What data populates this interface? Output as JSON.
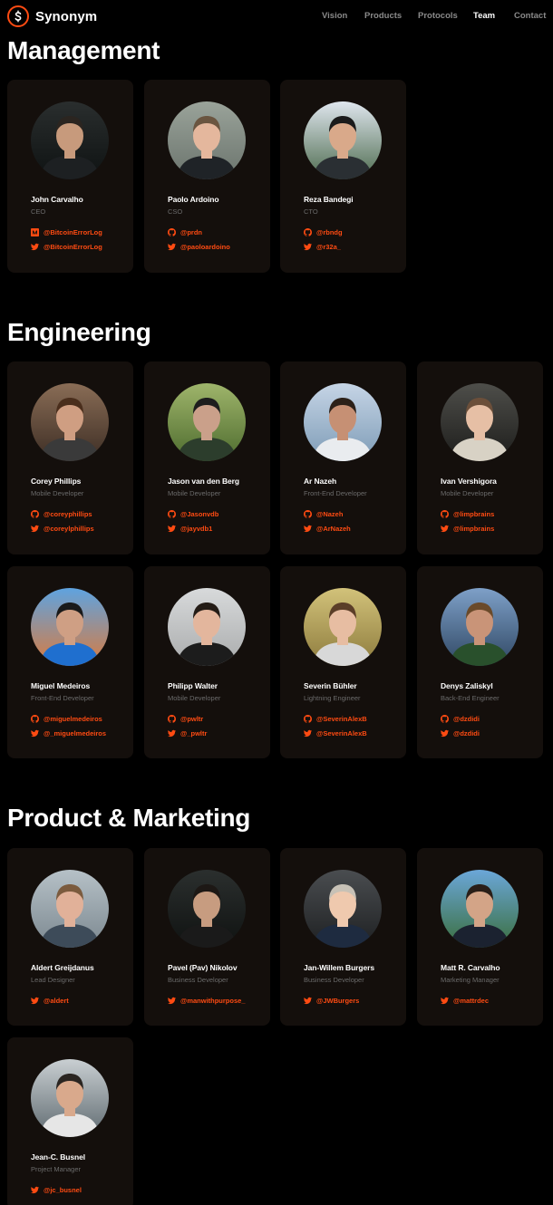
{
  "brand": {
    "name": "Synonym",
    "accent": "#ff4b12"
  },
  "nav": [
    {
      "label": "Vision"
    },
    {
      "label": "Products"
    },
    {
      "label": "Protocols"
    },
    {
      "label": "Team",
      "active": true
    },
    {
      "label": "Contact"
    }
  ],
  "sections": [
    {
      "title": "Management",
      "members": [
        {
          "name": "John Carvalho",
          "role": "CEO",
          "links": [
            {
              "icon": "medium-icon",
              "text": "@BitcoinErrorLog"
            },
            {
              "icon": "twitter-icon",
              "text": "@BitcoinErrorLog"
            }
          ]
        },
        {
          "name": "Paolo Ardoino",
          "role": "CSO",
          "links": [
            {
              "icon": "github-icon",
              "text": "@prdn"
            },
            {
              "icon": "twitter-icon",
              "text": "@paoloardoino"
            }
          ]
        },
        {
          "name": "Reza Bandegi",
          "role": "CTO",
          "links": [
            {
              "icon": "github-icon",
              "text": "@rbndg"
            },
            {
              "icon": "twitter-icon",
              "text": "@r32a_"
            }
          ]
        }
      ]
    },
    {
      "title": "Engineering",
      "members": [
        {
          "name": "Corey Phillips",
          "role": "Mobile Developer",
          "links": [
            {
              "icon": "github-icon",
              "text": "@coreyphillips"
            },
            {
              "icon": "twitter-icon",
              "text": "@coreylphillips"
            }
          ]
        },
        {
          "name": "Jason van den Berg",
          "role": "Mobile Developer",
          "links": [
            {
              "icon": "github-icon",
              "text": "@Jasonvdb"
            },
            {
              "icon": "twitter-icon",
              "text": "@jayvdb1"
            }
          ]
        },
        {
          "name": "Ar Nazeh",
          "role": "Front-End Developer",
          "links": [
            {
              "icon": "github-icon",
              "text": "@Nazeh"
            },
            {
              "icon": "twitter-icon",
              "text": "@ArNazeh"
            }
          ]
        },
        {
          "name": "Ivan Vershigora",
          "role": "Mobile Developer",
          "links": [
            {
              "icon": "github-icon",
              "text": "@limpbrains"
            },
            {
              "icon": "twitter-icon",
              "text": "@limpbrains"
            }
          ]
        },
        {
          "name": "Miguel Medeiros",
          "role": "Front-End Developer",
          "links": [
            {
              "icon": "github-icon",
              "text": "@miguelmedeiros"
            },
            {
              "icon": "twitter-icon",
              "text": "@_miguelmedeiros"
            }
          ]
        },
        {
          "name": "Philipp Walter",
          "role": "Mobile Developer",
          "links": [
            {
              "icon": "github-icon",
              "text": "@pwltr"
            },
            {
              "icon": "twitter-icon",
              "text": "@_pwltr"
            }
          ]
        },
        {
          "name": "Severin Bühler",
          "role": "Lightning Engineer",
          "links": [
            {
              "icon": "github-icon",
              "text": "@SeverinAlexB"
            },
            {
              "icon": "twitter-icon",
              "text": "@SeverinAlexB"
            }
          ]
        },
        {
          "name": "Denys Zaliskyl",
          "role": "Back-End Engineer",
          "links": [
            {
              "icon": "github-icon",
              "text": "@dzdidi"
            },
            {
              "icon": "twitter-icon",
              "text": "@dzdidi"
            }
          ]
        }
      ]
    },
    {
      "title": "Product & Marketing",
      "members": [
        {
          "name": "Aldert Greijdanus",
          "role": "Lead Designer",
          "links": [
            {
              "icon": "twitter-icon",
              "text": "@aldert"
            }
          ]
        },
        {
          "name": "Pavel (Pav) Nikolov",
          "role": "Business Developer",
          "links": [
            {
              "icon": "twitter-icon",
              "text": "@manwithpurpose_"
            }
          ]
        },
        {
          "name": "Jan-Willem Burgers",
          "role": "Business Developer",
          "links": [
            {
              "icon": "twitter-icon",
              "text": "@JWBurgers"
            }
          ]
        },
        {
          "name": "Matt R. Carvalho",
          "role": "Marketing Manager",
          "links": [
            {
              "icon": "twitter-icon",
              "text": "@mattrdec"
            }
          ]
        },
        {
          "name": "Jean-C. Busnel",
          "role": "Project Manager",
          "links": [
            {
              "icon": "twitter-icon",
              "text": "@jc_busnel"
            }
          ]
        }
      ]
    }
  ]
}
